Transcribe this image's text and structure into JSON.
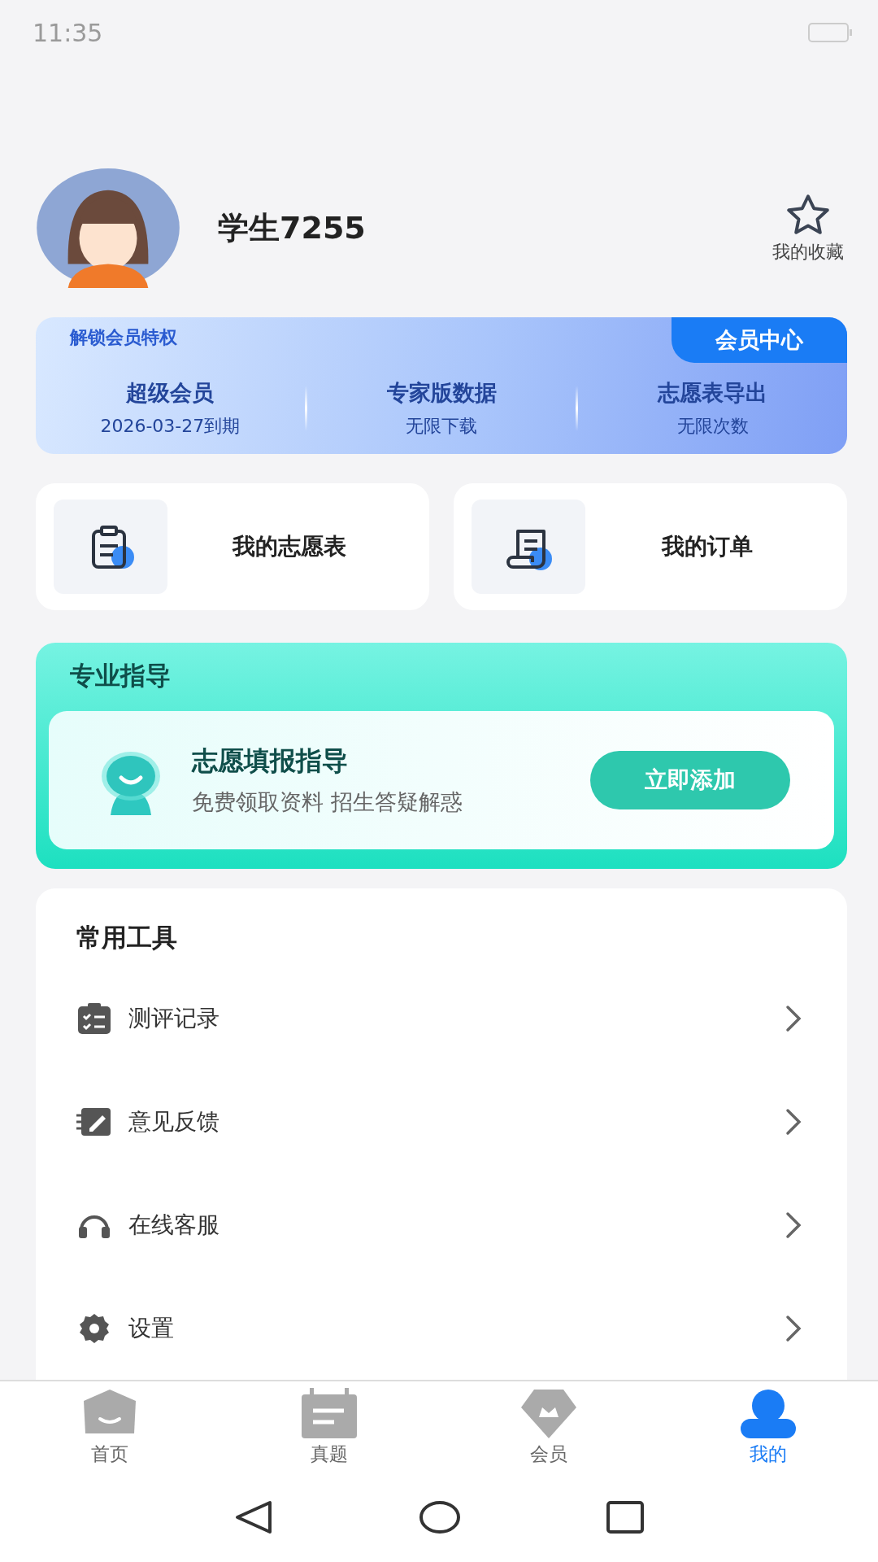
{
  "status_bar": {
    "time": "11:35"
  },
  "profile": {
    "username": "学生7255",
    "favorites_label": "我的收藏"
  },
  "membership": {
    "title": "解锁会员特权",
    "button": "会员中心",
    "features": [
      {
        "title": "超级会员",
        "subtitle": "2026-03-27到期"
      },
      {
        "title": "专家版数据",
        "subtitle": "无限下载"
      },
      {
        "title": "志愿表导出",
        "subtitle": "无限次数"
      }
    ]
  },
  "shortcuts": [
    {
      "label": "我的志愿表"
    },
    {
      "label": "我的订单"
    }
  ],
  "guidance": {
    "section_title": "专业指导",
    "title": "志愿填报指导",
    "subtitle": "免费领取资料 招生答疑解惑",
    "button": "立即添加"
  },
  "tools": {
    "title": "常用工具",
    "items": [
      {
        "label": "测评记录"
      },
      {
        "label": "意见反馈"
      },
      {
        "label": "在线客服"
      },
      {
        "label": "设置"
      }
    ]
  },
  "tab_bar": [
    {
      "label": "首页",
      "selected": false
    },
    {
      "label": "真题",
      "selected": false
    },
    {
      "label": "会员",
      "selected": false
    },
    {
      "label": "我的",
      "selected": true
    }
  ]
}
